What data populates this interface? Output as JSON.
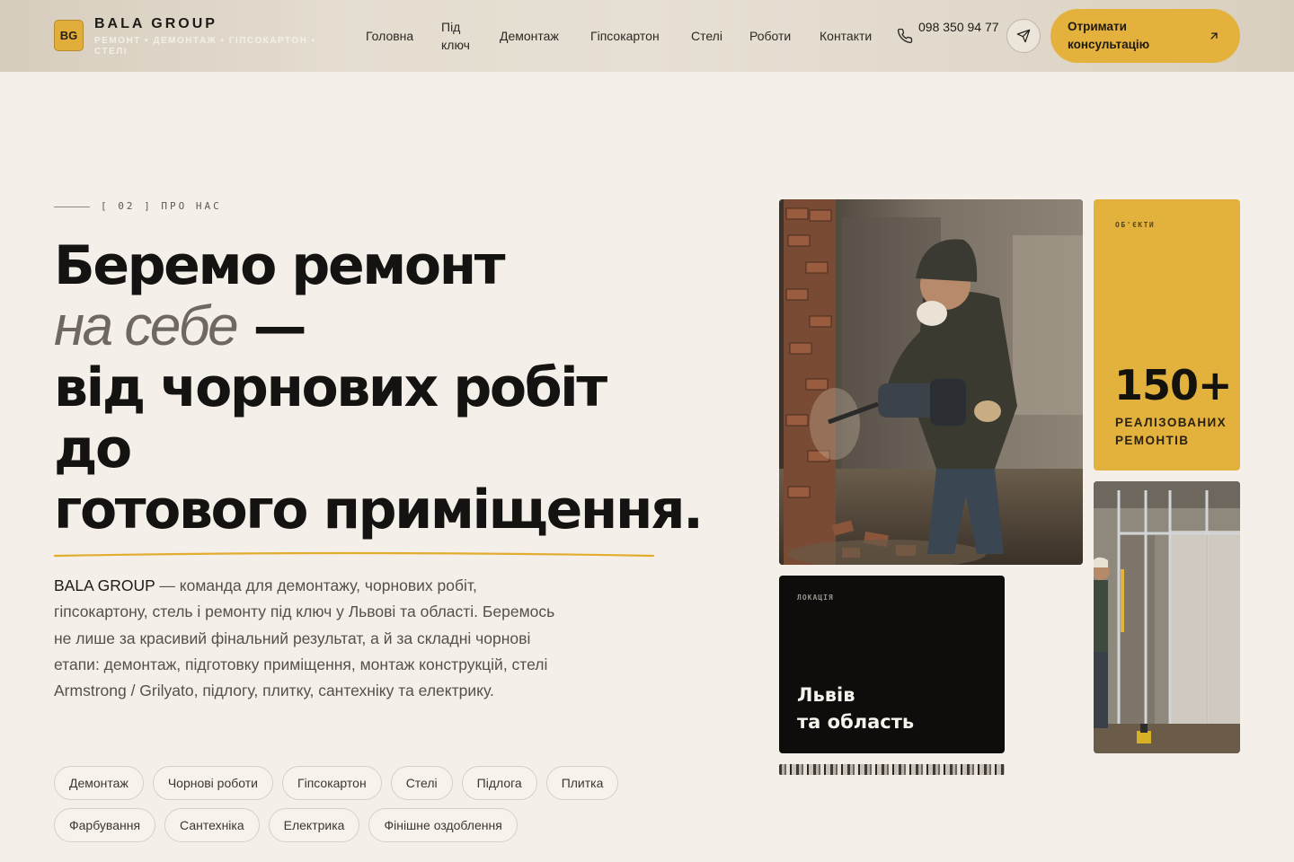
{
  "header": {
    "logo_mark": "BG",
    "brand_name": "BALA GROUP",
    "tagline": "РЕМОНТ • ДЕМОНТАЖ • ГІПСОКАРТОН • СТЕЛІ",
    "nav": [
      {
        "label": "Головна"
      },
      {
        "label": "Під ключ"
      },
      {
        "label": "Демонтаж"
      },
      {
        "label": "Гіпсокартон"
      },
      {
        "label": "Стелі"
      },
      {
        "label": "Роботи"
      },
      {
        "label": "Контакти"
      }
    ],
    "phone": "098 350 94 77",
    "phone_icon": "phone-icon",
    "telegram_icon": "send-icon",
    "cta_label": "Отримати консультацію",
    "cta_icon": "arrow-up-right-icon"
  },
  "section": {
    "label": "[ 02 ] ПРО НАС"
  },
  "headline": {
    "line1": "Беремо ремонт",
    "line2_italic": "на себе",
    "line2_dash": " —",
    "line3": "від чорнових робіт",
    "line4": "до",
    "line5": "готового приміщення."
  },
  "description": {
    "brand": "BALA GROUP",
    "text": " — команда для демонтажу, чорнових робіт, гіпсокартону, стель і ремонту під ключ у Львові та області. Беремось не лише за красивий фінальний результат, а й за складні чорнові етапи: демонтаж, підготовку приміщення, монтаж конструкцій, стелі Armstrong / Grilyato, підлогу, плитку, сантехніку та електрику."
  },
  "tags": [
    "Демонтаж",
    "Чорнові роботи",
    "Гіпсокартон",
    "Стелі",
    "Підлога",
    "Плитка",
    "Фарбування",
    "Сантехніка",
    "Електрика",
    "Фінішне оздоблення"
  ],
  "stat_card": {
    "eyebrow": "ОБ'ЄКТИ",
    "number": "150+",
    "caption": "РЕАЛІЗОВАНИХ РЕМОНТІВ"
  },
  "location_card": {
    "eyebrow": "ЛОКАЦІЯ",
    "title_line1": "Львів",
    "title_line2": "та область"
  },
  "colors": {
    "background": "#f4efe8",
    "accent": "#e2b23d",
    "dark_card": "#0e0d0c"
  }
}
